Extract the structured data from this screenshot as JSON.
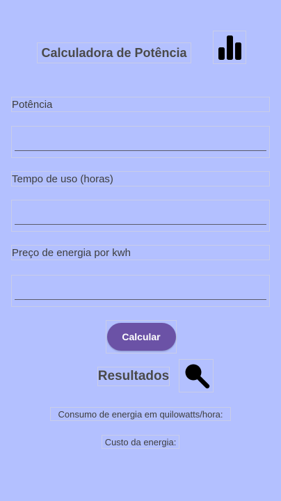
{
  "header": {
    "title": "Calculadora de Potência",
    "chart_icon": "bar-chart-icon"
  },
  "form": {
    "power_label": "Potência",
    "power_value": "",
    "time_label": "Tempo de uso (horas)",
    "time_value": "",
    "price_label": "Preço de energia por kwh",
    "price_value": "",
    "calculate_label": "Calcular"
  },
  "results": {
    "title": "Resultados",
    "search_icon": "search-icon",
    "consumption_label": "Consumo de energia em quilowatts/hora:",
    "cost_label": "Custo da energia:"
  },
  "colors": {
    "background": "#b3c0ff",
    "button": "#6b52a6",
    "button_text": "#ffffff"
  }
}
